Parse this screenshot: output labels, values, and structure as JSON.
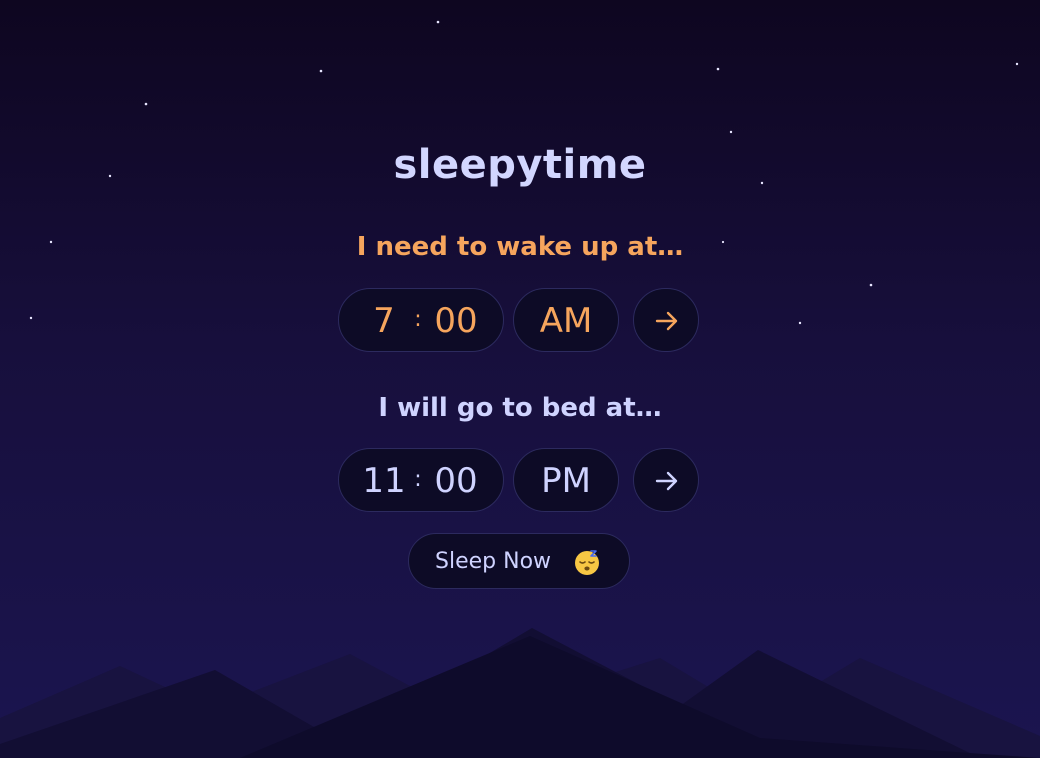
{
  "app": {
    "title": "sleepytime"
  },
  "wake": {
    "label": "I need to wake up at…",
    "hour": "7",
    "separator": ":",
    "minute": "00",
    "period": "AM"
  },
  "bed": {
    "label": "I will go to bed at…",
    "hour": "11",
    "separator": ":",
    "minute": "00",
    "period": "PM"
  },
  "sleep_now": {
    "label": "Sleep Now"
  },
  "icons": {
    "submit": "arrow-right-icon",
    "sleep": "sleeping-face-icon"
  },
  "colors": {
    "accent": "#f6a55d",
    "text": "#cfd3ff",
    "pill_bg": "#0d0b26",
    "pill_border": "#2c2a5e"
  }
}
